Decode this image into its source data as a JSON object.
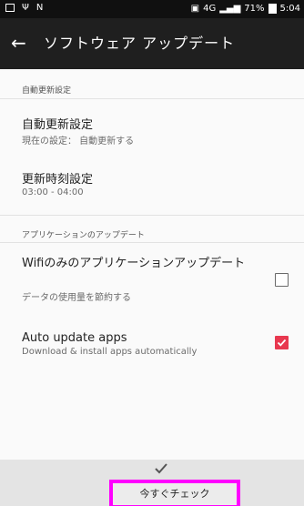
{
  "status_bar": {
    "signal_text": "4G",
    "battery": "71%",
    "time": "5:04"
  },
  "app_bar": {
    "title": "ソフトウェア アップデート"
  },
  "sections": {
    "auto_update_header": "自動更新設定",
    "app_update_header": "アプリケーションのアップデート"
  },
  "items": {
    "auto_update": {
      "title": "自動更新設定",
      "subtitle": "現在の設定： 自動更新する"
    },
    "update_time": {
      "title": "更新時刻設定",
      "subtitle": "03:00 - 04:00"
    },
    "wifi_only": {
      "title": "Wifiのみのアプリケーションアップデート",
      "subtitle": "データの使用量を節約する",
      "checked": false
    },
    "auto_update_apps": {
      "title": "Auto update apps",
      "subtitle": "Download & install apps automatically",
      "checked": true
    }
  },
  "bottom": {
    "check_now_label": "今すぐチェック"
  },
  "colors": {
    "accent": "#e8384f",
    "highlight": "#ff00ff",
    "app_bar": "#1f1f1f"
  }
}
